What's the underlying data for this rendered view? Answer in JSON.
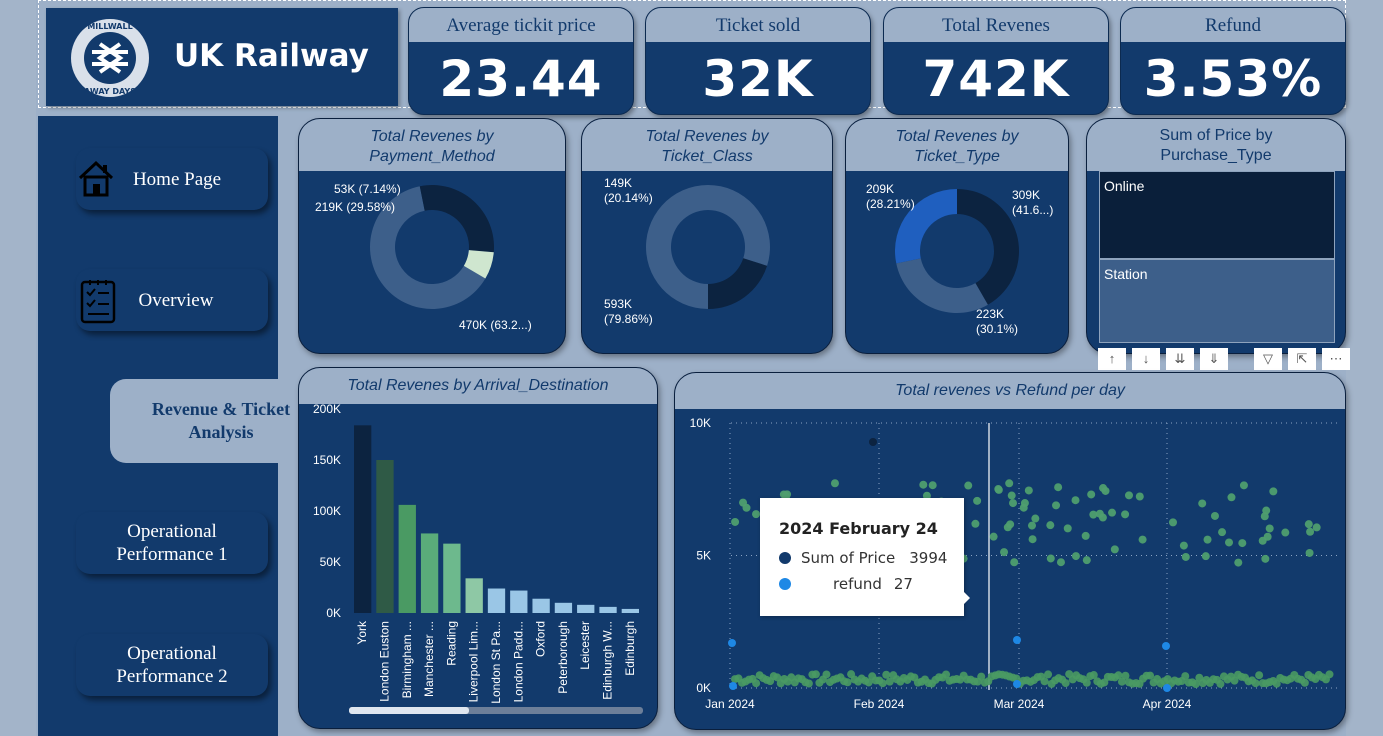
{
  "app": {
    "title": "UK Railway",
    "logo_text_top": "MILLWALL",
    "logo_text_bottom": "AWAY DAYS"
  },
  "kpis": [
    {
      "label": "Average tickit price",
      "value": "23.44"
    },
    {
      "label": "Ticket sold",
      "value": "32K"
    },
    {
      "label": "Total Revenes",
      "value": "742K"
    },
    {
      "label": "Refund",
      "value": "3.53%"
    }
  ],
  "nav": {
    "home": "Home Page",
    "overview": "Overview",
    "revenue": "Revenue & Ticket Analysis",
    "op1": "Operational Performance 1",
    "op2": "Operational Performance 2"
  },
  "colors": {
    "navy": "#123a6c",
    "panel": "#9db0c8",
    "dark": "#0c2340",
    "mid": "#3d5f8a",
    "light_green": "#cfe6cf",
    "blue": "#1f5fbf"
  },
  "donuts": [
    {
      "title": "Total Revenes by Payment_Method",
      "slices": [
        {
          "label": "470K (63.2...)",
          "value": 470,
          "color": "#3d5f8a"
        },
        {
          "label": "219K (29.58%)",
          "value": 219,
          "color": "#0c2340"
        },
        {
          "label": "53K (7.14%)",
          "value": 53,
          "color": "#cfe6cf"
        }
      ]
    },
    {
      "title": "Total Revenes by Ticket_Class",
      "slices": [
        {
          "label": "593K (79.86%)",
          "value": 593,
          "color": "#3d5f8a"
        },
        {
          "label": "149K (20.14%)",
          "value": 149,
          "color": "#0c2340"
        }
      ]
    },
    {
      "title": "Total Revenes by Ticket_Type",
      "slices": [
        {
          "label": "309K (41.6...)",
          "value": 309,
          "color": "#0c2340"
        },
        {
          "label": "223K (30.1%)",
          "value": 223,
          "color": "#3d5f8a"
        },
        {
          "label": "209K (28.21%)",
          "value": 209,
          "color": "#1f5fbf"
        }
      ]
    }
  ],
  "slicer": {
    "title": "Sum of Price by Purchase_Type",
    "items": [
      {
        "label": "Online"
      },
      {
        "label": "Station"
      }
    ]
  },
  "toolbar_icons": [
    "drill-up-icon",
    "drill-down-icon",
    "expand-all-icon",
    "expand-level-icon",
    "filter-icon",
    "focus-mode-icon",
    "more-options-icon"
  ],
  "bar_chart": {
    "title": "Total Revenes by Arrival_Destination"
  },
  "scatter": {
    "title": "Total revenes vs Refund per day",
    "tooltip": {
      "date": "2024 February 24",
      "price_label": "Sum of Price",
      "price_value": "3994",
      "refund_label": "refund",
      "refund_value": "27"
    }
  },
  "chart_data": [
    {
      "type": "bar",
      "title": "Total Revenes by Arrival_Destination",
      "categories": [
        "York",
        "London Euston",
        "Birmingham ...",
        "Manchester ...",
        "Reading",
        "Liverpool Lim...",
        "London St Pa...",
        "London Padd...",
        "Oxford",
        "Peterborough",
        "Leicester",
        "Edinburgh W...",
        "Edinburgh"
      ],
      "values": [
        184000,
        150000,
        106000,
        78000,
        68000,
        34000,
        24000,
        22000,
        14000,
        10000,
        8000,
        6000,
        4000
      ],
      "colors": [
        "#0c2340",
        "#2f5a46",
        "#4a9a63",
        "#5aac7a",
        "#6db98d",
        "#8ec8a5",
        "#9ac6e6",
        "#9ac6e6",
        "#9ac6e6",
        "#9ac6e6",
        "#9ac6e6",
        "#9ac6e6",
        "#9ac6e6"
      ],
      "yticks": [
        "0K",
        "50K",
        "100K",
        "150K",
        "200K"
      ],
      "ylim": [
        0,
        200000
      ]
    },
    {
      "type": "scatter",
      "title": "Total revenes vs Refund per day",
      "yticks": [
        "0K",
        "5K",
        "10K"
      ],
      "ylim": [
        0,
        10000
      ],
      "xticks": [
        "Jan 2024",
        "Feb 2024",
        "Mar 2024",
        "Apr 2024"
      ],
      "series": [
        {
          "name": "Sum of Price",
          "color": "#4a9a63"
        },
        {
          "name": "refund",
          "color": "#1e88e5"
        }
      ]
    }
  ]
}
